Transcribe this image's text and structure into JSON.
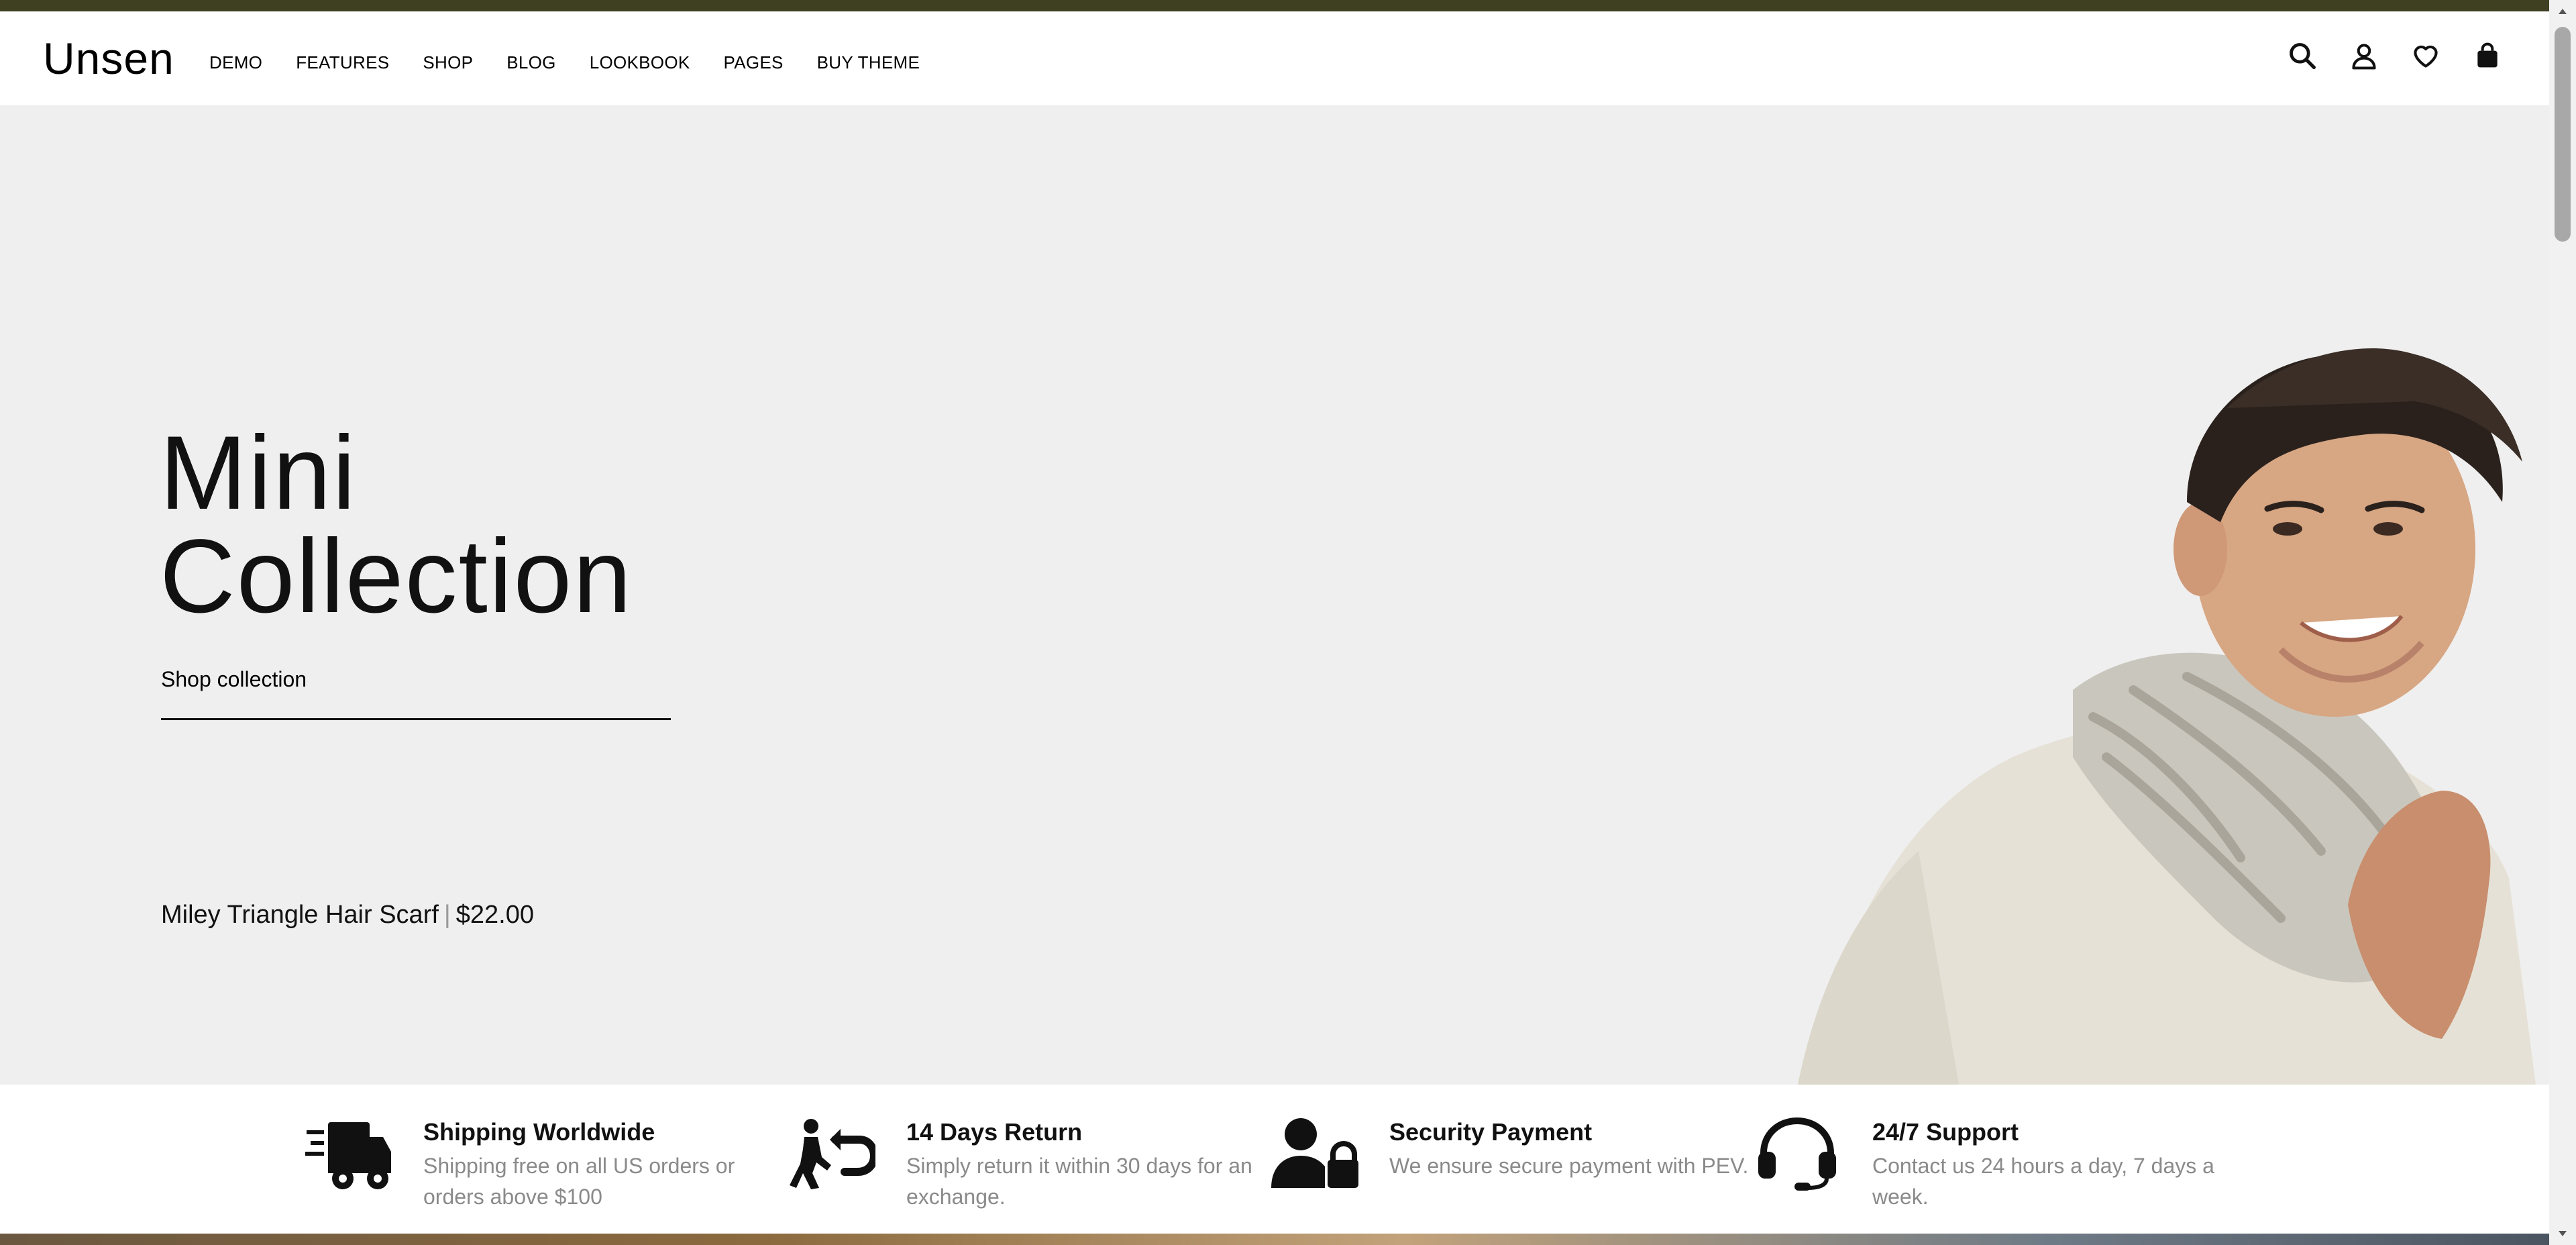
{
  "header": {
    "logo": "Unsen",
    "nav": [
      "DEMO",
      "FEATURES",
      "SHOP",
      "BLOG",
      "LOOKBOOK",
      "PAGES",
      "BUY THEME"
    ],
    "icons": [
      "search-icon",
      "account-icon",
      "wishlist-heart-icon",
      "cart-bag-icon"
    ]
  },
  "hero": {
    "title_line1": "Mini",
    "title_line2": "Collection",
    "link": "Shop collection",
    "product_name": "Miley Triangle Hair Scarf",
    "separator": "|",
    "product_price": "$22.00"
  },
  "features": [
    {
      "icon": "delivery-truck-icon",
      "title": "Shipping Worldwide",
      "desc": "Shipping free on all US orders or orders above $100"
    },
    {
      "icon": "return-icon",
      "title": "14 Days Return",
      "desc": "Simply return it within 30 days for an exchange."
    },
    {
      "icon": "user-lock-icon",
      "title": "Security Payment",
      "desc": "We ensure secure payment with PEV."
    },
    {
      "icon": "headset-icon",
      "title": "24/7 Support",
      "desc": "Contact us 24 hours a day, 7 days a week."
    }
  ],
  "colors": {
    "topbar": "#3f4022",
    "hero_bg": "#efefef",
    "text": "#111111",
    "muted": "#8a8a8a"
  }
}
